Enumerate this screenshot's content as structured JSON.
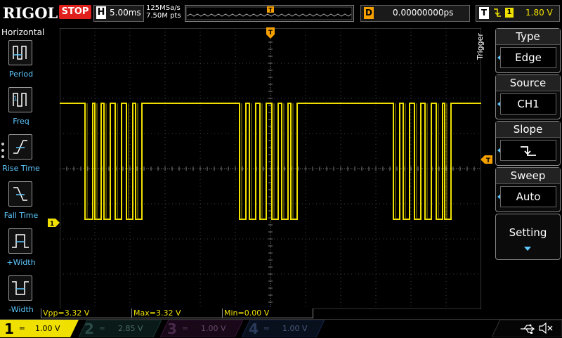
{
  "header": {
    "brand": "RIGOL",
    "run_state": "STOP",
    "timebase_letter": "H",
    "timebase": "5.00ms",
    "sample_rate": "125MSa/s",
    "memory_depth": "7.50M pts",
    "trigger_marker": "T",
    "delay_letter": "D",
    "delay": "0.00000000ps",
    "trigger_letter": "T",
    "trigger_channel": "1",
    "trigger_level": "1.80 V"
  },
  "left_menu": {
    "title": "Horizontal",
    "items": [
      {
        "label": "Period",
        "icon": "period-icon"
      },
      {
        "label": "Freq",
        "icon": "frequency-icon"
      },
      {
        "label": "Rise Time",
        "icon": "rise-time-icon"
      },
      {
        "label": "Fall Time",
        "icon": "fall-time-icon"
      },
      {
        "label": "+Width",
        "icon": "positive-width-icon"
      },
      {
        "label": "-Width",
        "icon": "negative-width-icon"
      }
    ]
  },
  "trigger_menu": {
    "title": "Trigger",
    "items": [
      {
        "header": "Type",
        "value": "Edge"
      },
      {
        "header": "Source",
        "value": "CH1"
      },
      {
        "header": "Slope",
        "value": "falling-edge-icon"
      },
      {
        "header": "Sweep",
        "value": "Auto"
      }
    ],
    "setting": "Setting"
  },
  "measurements": {
    "vpp": "Vpp=3.32 V",
    "max": "Max=3.32 V",
    "min": "Min=0.00 V"
  },
  "channels": [
    {
      "num": "1",
      "scale": "1.00 V",
      "color": "#f0e000"
    },
    {
      "num": "2",
      "scale": "2.85 V",
      "color": "#00d4c0"
    },
    {
      "num": "3",
      "scale": "1.00 V",
      "color": "#d030d0"
    },
    {
      "num": "4",
      "scale": "1.00 V",
      "color": "#3f7fff"
    }
  ],
  "markers": {
    "ch1_ground": "1"
  },
  "colors": {
    "ch1": "#f0e000",
    "accent": "#5ec8ff",
    "trigger": "#f6a000",
    "stop": "#e0201c"
  }
}
